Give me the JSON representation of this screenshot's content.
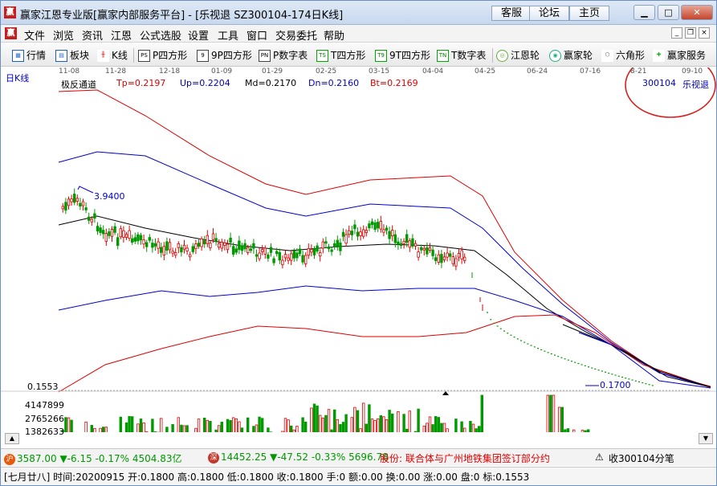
{
  "window": {
    "title": "赢家江恩专业版[赢家内部服务平台] - [乐视退  SZ300104-174日K线]",
    "top_buttons": [
      "客服",
      "论坛",
      "主页"
    ],
    "app_logo": "赢"
  },
  "menu": {
    "items": [
      "文件",
      "浏览",
      "资讯",
      "江恩",
      "公式选股",
      "设置",
      "工具",
      "窗口",
      "交易委托",
      "帮助"
    ]
  },
  "toolbar": {
    "items": [
      {
        "label": "行情",
        "icon": "grid-icon"
      },
      {
        "label": "板块",
        "icon": "blocks-icon"
      },
      {
        "label": "K线",
        "icon": "candles-icon"
      },
      {
        "label": "P四方形",
        "icon_text": "PS"
      },
      {
        "label": "9P四方形",
        "icon_text": "9"
      },
      {
        "label": "P数字表",
        "icon_text": "PN"
      },
      {
        "label": "T四方形",
        "icon_text": "TS"
      },
      {
        "label": "9T四方形",
        "icon_text": "T9"
      },
      {
        "label": "T数字表",
        "icon_text": "TN"
      },
      {
        "label": "江恩轮",
        "icon": "wheel-icon"
      },
      {
        "label": "赢家轮",
        "icon": "yingjia-wheel-icon"
      },
      {
        "label": "六角形",
        "icon": "hexagon-icon"
      },
      {
        "label": "赢家服务",
        "icon": "service-icon"
      }
    ]
  },
  "chart": {
    "period_label": "日K线",
    "dates": [
      "11-08",
      "11-28",
      "12-18",
      "01-09",
      "01-29",
      "02-25",
      "03-15",
      "04-04",
      "04-25",
      "06-24",
      "07-16",
      "8-21",
      "09-10"
    ],
    "indicator_name": "极反通道",
    "indicators": [
      {
        "label": "Tp=0.2197",
        "color": "#e00000"
      },
      {
        "label": "Up=0.2204",
        "color": "#0000cc"
      },
      {
        "label": "Md=0.2170",
        "color": "#000000"
      },
      {
        "label": "Dn=0.2160",
        "color": "#0000cc"
      },
      {
        "label": "Bt=0.2169",
        "color": "#e00000"
      }
    ],
    "stock_code": "300104",
    "stock_name": "乐视退",
    "high_label": "3.9400",
    "low_label": "0.1700",
    "price_axis_label": "0.1553",
    "volume_axis": [
      "4147899",
      "2765266",
      "1382633"
    ],
    "colors": {
      "up": "#e00000",
      "down": "#009900",
      "upper_band": "#e00000",
      "mid_band": "#0000cc",
      "center": "#000000",
      "annotation": "#d62020"
    }
  },
  "status": {
    "sh_index_badge": "沪",
    "sh_index": "3587.00",
    "sh_change": "▼-6.15",
    "sh_pct": "-0.17%",
    "sh_amount": "4504.83亿",
    "sz_index_badge": "深",
    "sz_index": "14452.25",
    "sz_change": "▼-47.52",
    "sz_pct": "-0.33%",
    "sz_amount": "5696.78",
    "news": "股份:  联合体与广州地铁集团签订部分约",
    "bell_text": "收300104分笔",
    "quote_line": "[七月廿八] 时间:20200915 开:0.1800 高:0.1800 低:0.1800 收:0.1800 手:0 额:0.00 换:0.00 涨:0.00 盘:0 标:0.1553"
  }
}
